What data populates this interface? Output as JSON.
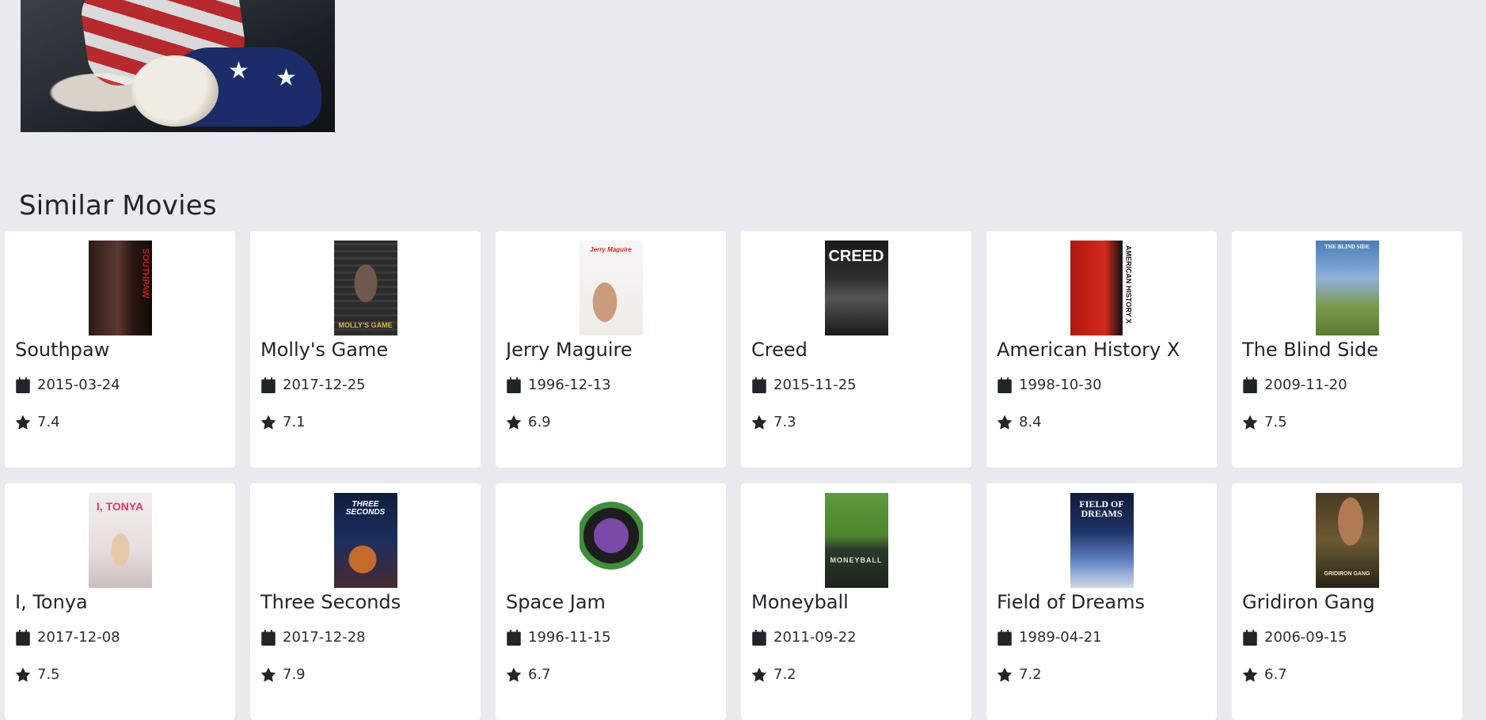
{
  "section_title": "Similar Movies",
  "movies": [
    {
      "title": "Southpaw",
      "date": "2015-03-24",
      "rating": "7.4",
      "poster_text": "SOUTHPAW"
    },
    {
      "title": "Molly's Game",
      "date": "2017-12-25",
      "rating": "7.1",
      "poster_text": "MOLLY'S GAME"
    },
    {
      "title": "Jerry Maguire",
      "date": "1996-12-13",
      "rating": "6.9",
      "poster_text": "Jerry Maguire"
    },
    {
      "title": "Creed",
      "date": "2015-11-25",
      "rating": "7.3",
      "poster_text": "CREED"
    },
    {
      "title": "American History X",
      "date": "1998-10-30",
      "rating": "8.4",
      "poster_text": "AMERICAN HISTORY X"
    },
    {
      "title": "The Blind Side",
      "date": "2009-11-20",
      "rating": "7.5",
      "poster_text": "THE BLIND SIDE"
    },
    {
      "title": "I, Tonya",
      "date": "2017-12-08",
      "rating": "7.5",
      "poster_text": "I, TONYA"
    },
    {
      "title": "Three Seconds",
      "date": "2017-12-28",
      "rating": "7.9",
      "poster_text": "THREE SECONDS"
    },
    {
      "title": "Space Jam",
      "date": "1996-11-15",
      "rating": "6.7",
      "poster_text": ""
    },
    {
      "title": "Moneyball",
      "date": "2011-09-22",
      "rating": "7.2",
      "poster_text": "MONEYBALL"
    },
    {
      "title": "Field of Dreams",
      "date": "1989-04-21",
      "rating": "7.2",
      "poster_text": "FIELD OF DREAMS"
    },
    {
      "title": "Gridiron Gang",
      "date": "2006-09-15",
      "rating": "6.7",
      "poster_text": "GRIDIRON GANG"
    }
  ],
  "icons": {
    "date": "calendar-icon",
    "rating": "star-icon"
  },
  "colors": {
    "page_bg": "#e9eaee",
    "card_bg": "#ffffff",
    "text": "#212529"
  }
}
